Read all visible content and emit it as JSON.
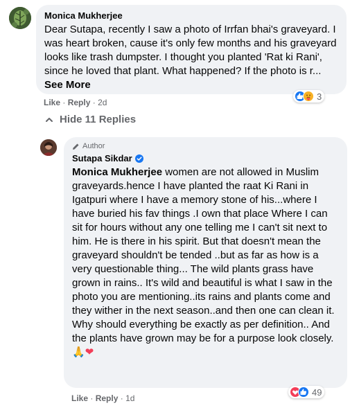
{
  "comment": {
    "author": "Monica Mukherjee",
    "text": "Dear Sutapa, recently I saw a photo of Irrfan bhai's graveyard. I was heart broken, cause it's only few months and his graveyard looks like trash dumpster. I thought you planted 'Rat ki Rani', since he loved that plant. What happened? If the photo is r...",
    "see_more": "See More",
    "like_label": "Like",
    "reply_label": "Reply",
    "time": "2d",
    "reaction_count": "3",
    "reaction_icons": [
      "like-icon",
      "care-icon"
    ]
  },
  "hide_replies_label": "Hide 11 Replies",
  "reply": {
    "author_badge": "Author",
    "author": "Sutapa Sikdar",
    "verified": true,
    "mention": "Monica Mukherjee",
    "text": "women are not allowed in Muslim graveyards.hence I have planted the raat Ki Rani in Igatpuri where I have a memory stone of his...where I have buried his fav things .I own that place Where I can sit for hours without any one telling me I can't sit next to him. He is there in his spirit. But that doesn't mean the graveyard shouldn't be tended ..but as far as how is a very questionable thing... The wild plants grass have grown in rains.. It's wild and beautiful is what I saw in the photo you are mentioning..its rains and plants come and they wither in the next season..and then one can clean it. Why should everything be exactly as per definition.. And the plants have grown may be for a purpose look closely.",
    "emojis": "🙏❤",
    "like_label": "Like",
    "reply_label": "Reply",
    "time": "1d",
    "reaction_count": "49",
    "reaction_icons": [
      "care-icon",
      "like-icon"
    ]
  },
  "colors": {
    "bubble": "#f0f2f5",
    "like_blue": "#1877f2",
    "love_red": "#f33e58",
    "meta_gray": "#65676b"
  }
}
